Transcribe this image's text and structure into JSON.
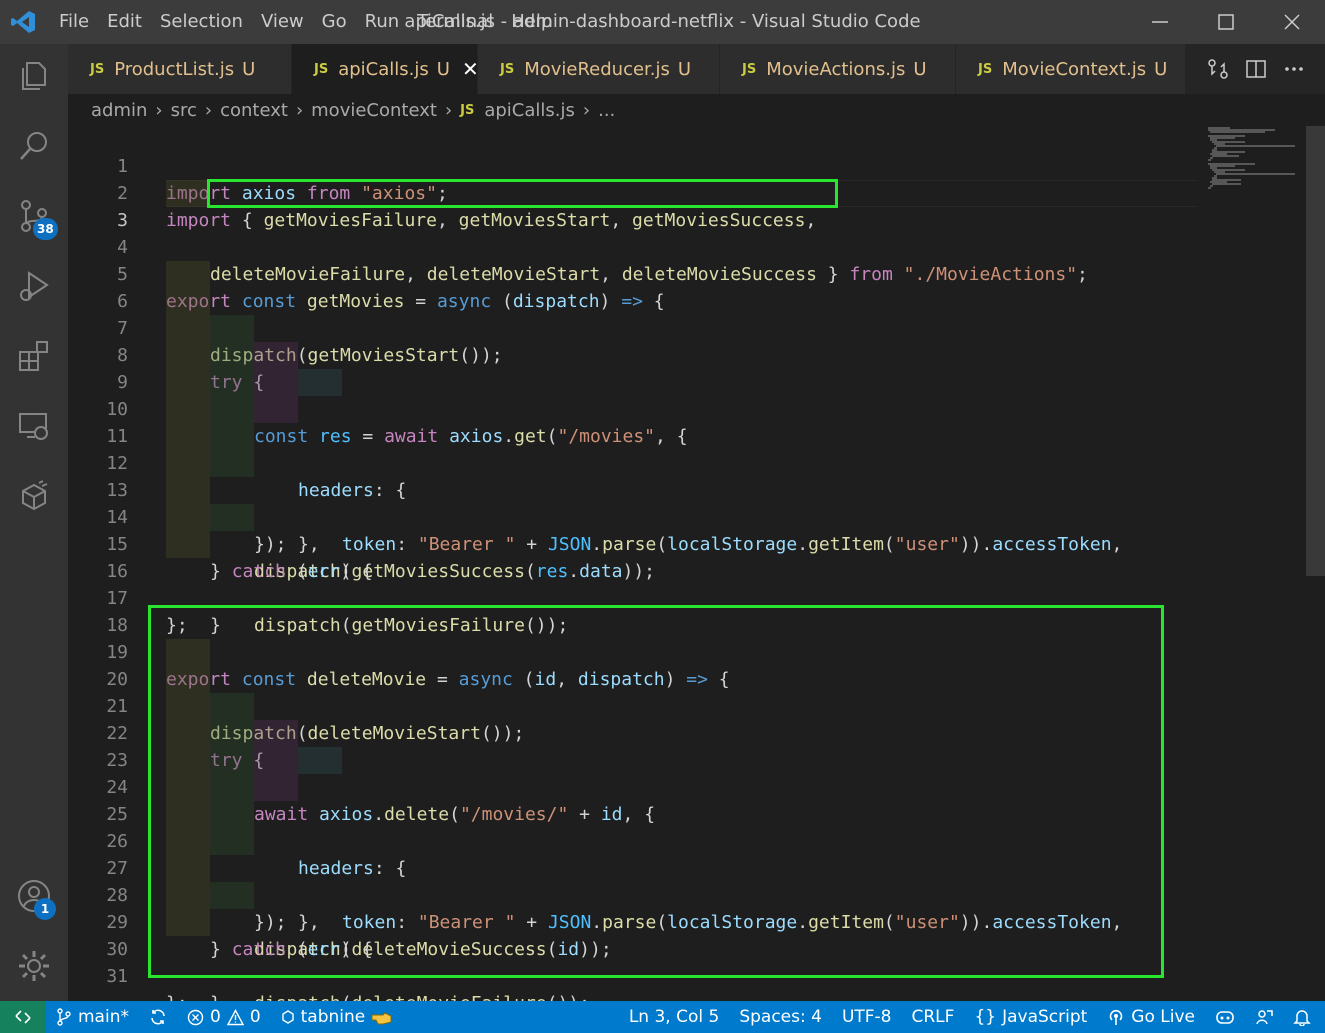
{
  "titlebar": {
    "menu": [
      "File",
      "Edit",
      "Selection",
      "View",
      "Go",
      "Run",
      "Terminal",
      "Help"
    ],
    "title": "apiCalls.js - admin-dashboard-netflix - Visual Studio Code"
  },
  "activitybar": {
    "source_control_badge": "38",
    "accounts_badge": "1"
  },
  "tabs": [
    {
      "icon": "JS",
      "label": "ProductList.js",
      "status": "U"
    },
    {
      "icon": "JS",
      "label": "apiCalls.js",
      "status": "U",
      "active": true
    },
    {
      "icon": "JS",
      "label": "MovieReducer.js",
      "status": "U"
    },
    {
      "icon": "JS",
      "label": "MovieActions.js",
      "status": "U"
    },
    {
      "icon": "JS",
      "label": "MovieContext.js",
      "status": "U"
    }
  ],
  "breadcrumb": {
    "parts": [
      "admin",
      "src",
      "context",
      "movieContext"
    ],
    "file_icon": "JS",
    "file": "apiCalls.js",
    "trail": "..."
  },
  "line_numbers": [
    "1",
    "2",
    "3",
    "4",
    "5",
    "6",
    "7",
    "8",
    "9",
    "10",
    "11",
    "12",
    "13",
    "14",
    "15",
    "16",
    "17",
    "18",
    "19",
    "20",
    "21",
    "22",
    "23",
    "24",
    "25",
    "26",
    "27",
    "28",
    "29",
    "30",
    "31"
  ],
  "code": {
    "l1": [
      "import",
      " axios ",
      "from",
      " ",
      "\"axios\"",
      ";"
    ],
    "l2": [
      "import",
      " ",
      "{",
      " ",
      "getMoviesFailure",
      ", ",
      "getMoviesStart",
      ", ",
      "getMoviesSuccess",
      ","
    ],
    "l3": [
      "deleteMovieFailure",
      ", ",
      "deleteMovieStart",
      ", ",
      "deleteMovieSuccess",
      " ",
      "}",
      " ",
      "from",
      " ",
      "\"./MovieActions\"",
      ";"
    ],
    "l5": [
      "export",
      " ",
      "const",
      " ",
      "getMovies",
      " = ",
      "async",
      " (",
      "dispatch",
      ") ",
      "=>",
      " {"
    ],
    "l6": [
      "dispatch",
      "(",
      "getMoviesStart",
      "());"
    ],
    "l7": [
      "try",
      " {"
    ],
    "l8": [
      "const",
      " ",
      "res",
      " = ",
      "await",
      " ",
      "axios",
      ".",
      "get",
      "(",
      "\"/movies\"",
      ", {"
    ],
    "l9": [
      "headers",
      ": {"
    ],
    "l10": [
      "token",
      ": ",
      "\"Bearer \"",
      " + ",
      "JSON",
      ".",
      "parse",
      "(",
      "localStorage",
      ".",
      "getItem",
      "(",
      "\"user\"",
      "))",
      ".",
      "accessToken",
      ","
    ],
    "l11": [
      "},"
    ],
    "l12": [
      "});"
    ],
    "l13": [
      "dispatch",
      "(",
      "getMoviesSuccess",
      "(",
      "res",
      ".",
      "data",
      "));"
    ],
    "l14": [
      "} ",
      "catch",
      " (",
      "err",
      ") {"
    ],
    "l15": [
      "dispatch",
      "(",
      "getMoviesFailure",
      "());"
    ],
    "l16": [
      "}"
    ],
    "l17": [
      "};"
    ],
    "l19": [
      "export",
      " ",
      "const",
      " ",
      "deleteMovie",
      " = ",
      "async",
      " (",
      "id",
      ", ",
      "dispatch",
      ") ",
      "=>",
      " {"
    ],
    "l20": [
      "dispatch",
      "(",
      "deleteMovieStart",
      "());"
    ],
    "l21": [
      "try",
      " {"
    ],
    "l22": [
      "await",
      " ",
      "axios",
      ".",
      "delete",
      "(",
      "\"/movies/\"",
      " + ",
      "id",
      ", {"
    ],
    "l23": [
      "headers",
      ": {"
    ],
    "l24": [
      "token",
      ": ",
      "\"Bearer \"",
      " + ",
      "JSON",
      ".",
      "parse",
      "(",
      "localStorage",
      ".",
      "getItem",
      "(",
      "\"user\"",
      "))",
      ".",
      "accessToken",
      ","
    ],
    "l25": [
      "},"
    ],
    "l26": [
      "});"
    ],
    "l27": [
      "dispatch",
      "(",
      "deleteMovieSuccess",
      "(",
      "id",
      "));"
    ],
    "l28": [
      "} ",
      "catch",
      " (",
      "err",
      ") {"
    ],
    "l29": [
      "dispatch",
      "(",
      "deleteMovieFailure",
      "());"
    ],
    "l30": [
      "}"
    ],
    "l31": [
      "};"
    ]
  },
  "statusbar": {
    "branch": "main*",
    "errors": "0",
    "warnings": "0",
    "tabnine": "tabnine",
    "position": "Ln 3, Col 5",
    "spaces": "Spaces: 4",
    "encoding": "UTF-8",
    "eol": "CRLF",
    "language": "JavaScript",
    "golive": "Go Live"
  },
  "colors": {
    "highlight": "#29e52f",
    "statusbar": "#007acc",
    "remote": "#16825d",
    "badge": "#0e70c0"
  }
}
